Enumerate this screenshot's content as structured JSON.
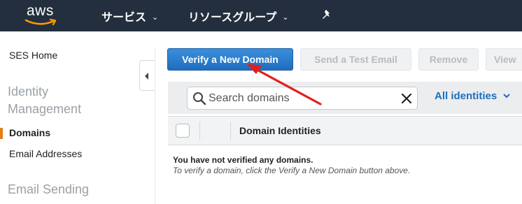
{
  "header": {
    "logo_text": "aws",
    "services_label": "サービス",
    "resource_groups_label": "リソースグループ",
    "pin_icon": "pin-icon",
    "nav_bg": "#232f3e"
  },
  "sidebar": {
    "home": "SES Home",
    "identity_heading_line1": "Identity",
    "identity_heading_line2": "Management",
    "items": [
      {
        "label": "Domains",
        "active": true
      },
      {
        "label": "Email Addresses",
        "active": false
      }
    ],
    "sending_heading": "Email Sending",
    "active_color": "#e37e1b"
  },
  "actions": {
    "verify_label": "Verify a New Domain",
    "test_email_label": "Send a Test Email",
    "remove_label": "Remove",
    "view_label": "View"
  },
  "search": {
    "placeholder": "Search domains",
    "filter_label": "All identities"
  },
  "table": {
    "column_header": "Domain Identities",
    "empty_title": "You have not verified any domains.",
    "empty_hint": "To verify a domain, click the Verify a New Domain button above."
  },
  "annotation": {
    "arrow_color": "#e21f1f"
  },
  "colors": {
    "primary": "#1f6dbe",
    "link": "#1f6dbe"
  }
}
